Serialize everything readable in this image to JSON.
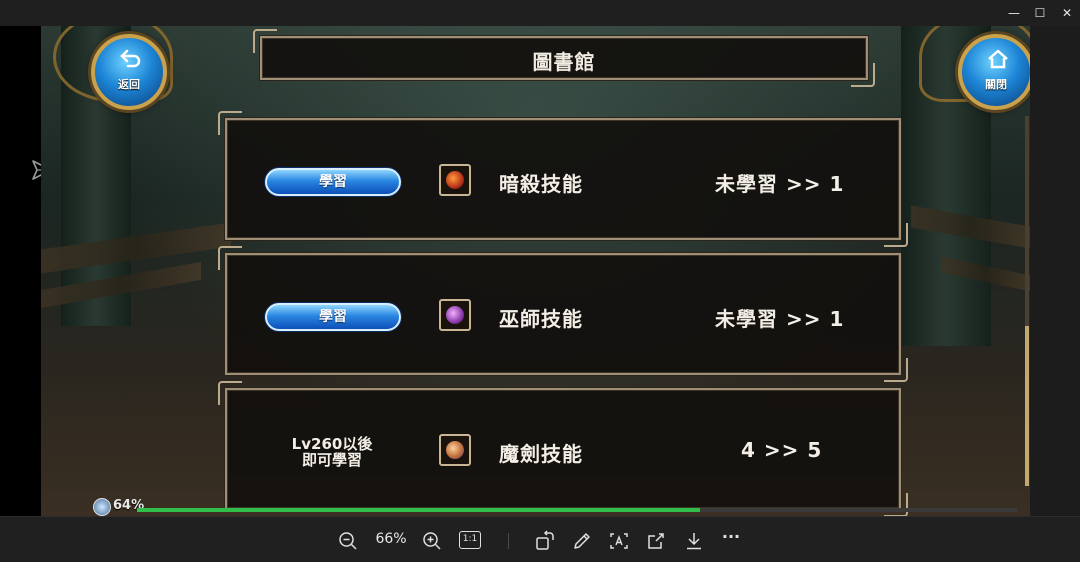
{
  "window": {
    "minimize_glyph": "—",
    "maximize_glyph": "☐",
    "close_glyph": "✕"
  },
  "game": {
    "title": "圖書館",
    "back_button_label": "返回",
    "close_button_label": "關閉",
    "skills": [
      {
        "action": "學習",
        "name": "暗殺技能",
        "progress": "未學習 >> 1",
        "icon": "assassin-skill-icon"
      },
      {
        "action": "學習",
        "name": "巫師技能",
        "progress": "未學習 >> 1",
        "icon": "wizard-skill-icon"
      },
      {
        "requirement_line1": "Lv260以後",
        "requirement_line2": "即可學習",
        "name": "魔劍技能",
        "progress": "4 >> 5",
        "icon": "magic-sword-skill-icon"
      }
    ],
    "exp_percent_text": "64%",
    "exp_fraction": 0.64
  },
  "viewer_toolbar": {
    "zoom_level": "66%",
    "actual_size_label": "1:1",
    "more_glyph": "···"
  },
  "colors": {
    "frame_border": "#a08f77",
    "button_blue": "#2a86e0",
    "exp_green": "#2fbf4a"
  }
}
